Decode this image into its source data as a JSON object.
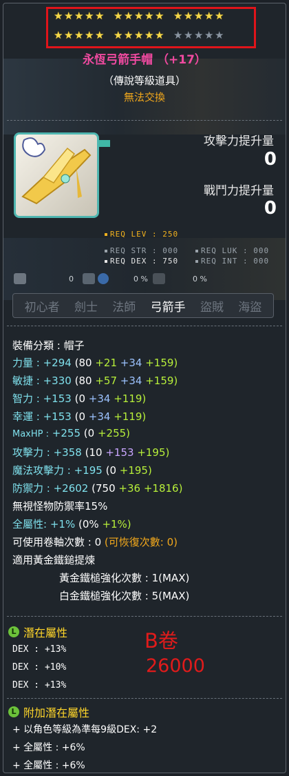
{
  "stars": {
    "row1": [
      5,
      5,
      5
    ],
    "row2": {
      "filled": 10,
      "empty": 5
    }
  },
  "item": {
    "name": "永恆弓箭手帽 （+17）",
    "grade": "（傳說等級道具）",
    "trade": "無法交換",
    "icon": "golden-winged-hat-icon"
  },
  "increase": {
    "attack_label": "攻擊力提升量",
    "attack_value": "0",
    "combat_label": "戰鬥力提升量",
    "combat_value": "0"
  },
  "requirements": {
    "lev": "REQ LEV : 250",
    "str": "REQ STR : 000",
    "luk": "REQ LUK : 000",
    "dex": "REQ DEX : 750",
    "int": "REQ INT : 000"
  },
  "icons_row": {
    "v1": "0",
    "v2": "0 %",
    "v3": "0 %"
  },
  "jobs": [
    "初心者",
    "劍士",
    "法師",
    "弓箭手",
    "盜賊",
    "海盜"
  ],
  "active_job": "弓箭手",
  "stats": {
    "category": "裝備分類 : 帽子",
    "str": {
      "label": "力量 :",
      "total": "+294",
      "base": "(80",
      "a": "+21",
      "b": "+34",
      "c": "+159)"
    },
    "dex": {
      "label": "敏捷 :",
      "total": "+330",
      "base": "(80",
      "a": "+57",
      "b": "+34",
      "c": "+159)"
    },
    "int": {
      "label": "智力 :",
      "total": "+153",
      "base": "(0",
      "b": "+34",
      "c": "+119)"
    },
    "luk": {
      "label": "幸運 :",
      "total": "+153",
      "base": "(0",
      "b": "+34",
      "c": "+119)"
    },
    "maxhp": {
      "label": "MaxHP :",
      "total": "+255",
      "base": "(0",
      "c": "+255)"
    },
    "atk": {
      "label": "攻擊力 :",
      "total": "+358",
      "base": "(10",
      "b": "+153",
      "c": "+195)"
    },
    "matk": {
      "label": "魔法攻擊力 :",
      "total": "+195",
      "base": "(0",
      "c": "+195)"
    },
    "def": {
      "label": "防禦力 :",
      "total": "+2602",
      "base": "(750",
      "a": "+36",
      "c": "+1816)"
    },
    "ignore": "無視怪物防禦率15%",
    "allstat": {
      "label": "全屬性:",
      "total": "+1%",
      "base": "(0%",
      "c": "+1%)"
    },
    "scrolls": "可使用卷軸次數 : 0",
    "restore": "(可恢復次數: 0)",
    "hammer": "適用黃金鐵鎚提煉",
    "gold_hammer": "黃金鐵槌強化次數 : 1(MAX)",
    "plat_hammer": "白金鐵槌強化次數 : 5(MAX)"
  },
  "potential": {
    "title": "潛在屬性",
    "icon_letter": "L",
    "lines": [
      "DEX : +13%",
      "DEX : +10%",
      "DEX : +13%"
    ]
  },
  "bonus_potential": {
    "title": "附加潛在屬性",
    "icon_letter": "L",
    "lines": [
      "+ 以角色等級為準每9級DEX: +2",
      "+ 全屬性 : +6%",
      "+ 全屬性 : +6%"
    ]
  },
  "annotation": {
    "line1": "B卷",
    "line2": "26000"
  }
}
